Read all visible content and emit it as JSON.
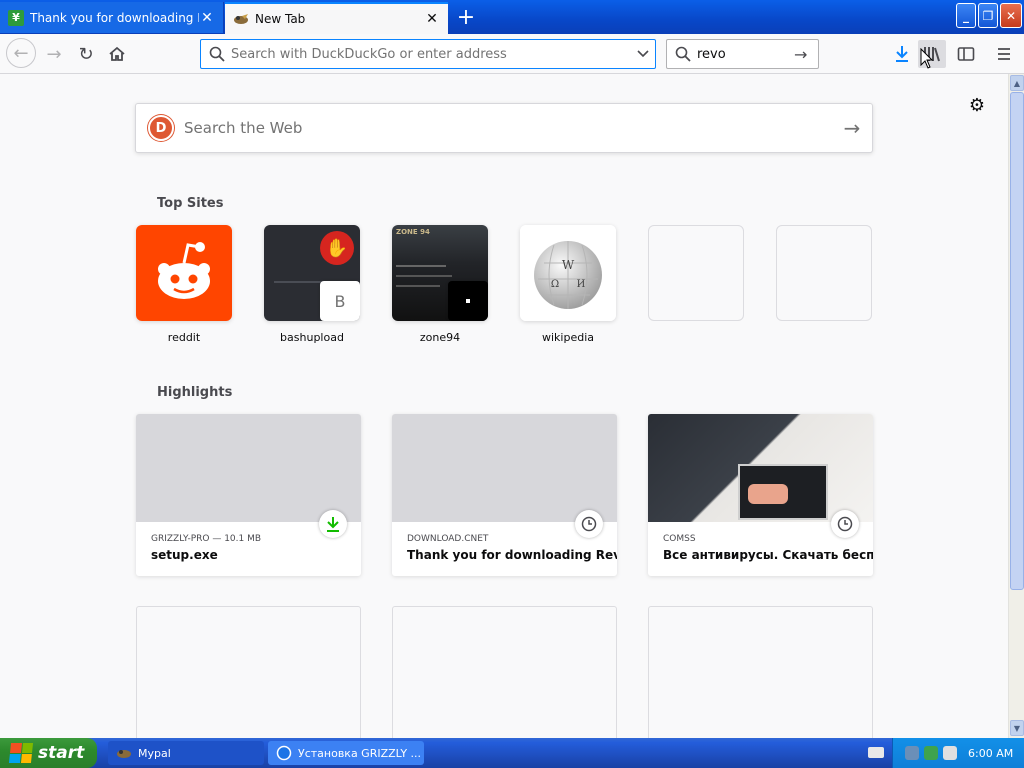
{
  "tabs": [
    {
      "title": "Thank you for downloading Revo Uni",
      "active": false
    },
    {
      "title": "New Tab",
      "active": true
    }
  ],
  "toolbar": {
    "url_placeholder": "Search with DuckDuckGo or enter address",
    "search_value": "revo"
  },
  "newtab": {
    "search_placeholder": "Search the Web",
    "top_sites_title": "Top Sites",
    "highlights_title": "Highlights",
    "top_sites": [
      {
        "label": "reddit"
      },
      {
        "label": "bashupload",
        "badge": "B"
      },
      {
        "label": "zone94",
        "thumb_text": "ZONE 94"
      },
      {
        "label": "wikipedia"
      },
      {
        "label": ""
      },
      {
        "label": ""
      }
    ],
    "highlights": [
      {
        "meta": "GRIZZLY-PRO — 10.1 MB",
        "title": "setup.exe",
        "icon": "download-icon"
      },
      {
        "meta": "DOWNLOAD.CNET",
        "title": "Thank you for downloading Rev...",
        "icon": "clock-icon"
      },
      {
        "meta": "COMSS",
        "title": "Все антивирусы. Скачать бесп...",
        "icon": "clock-icon"
      }
    ]
  },
  "taskbar": {
    "start_label": "start",
    "tasks": [
      {
        "label": "Mypal"
      },
      {
        "label": "Установка GRIZZLY ..."
      }
    ],
    "clock": "6:00 AM"
  },
  "colors": {
    "accent": "#0a84ff",
    "reddit": "#ff4500",
    "ddg": "#de5833",
    "download_green": "#12bc00"
  }
}
